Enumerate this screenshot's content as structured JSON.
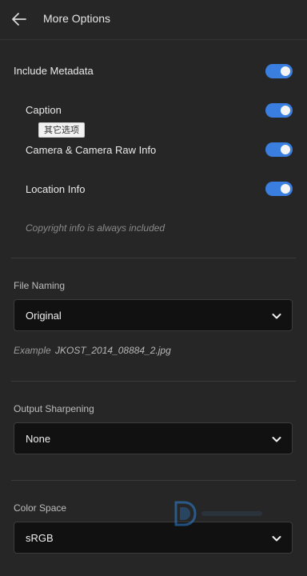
{
  "header": {
    "title": "More Options",
    "back_icon": "arrow-left-icon"
  },
  "metadata": {
    "include_label": "Include Metadata",
    "include_on": true,
    "items": [
      {
        "label": "Caption",
        "on": true
      },
      {
        "label": "Camera & Camera Raw Info",
        "on": true
      },
      {
        "label": "Location Info",
        "on": true
      }
    ],
    "tooltip": "其它选项",
    "note": "Copyright info is always included"
  },
  "file_naming": {
    "label": "File Naming",
    "value": "Original",
    "example_label": "Example",
    "example_value": "JKOST_2014_08884_2.jpg"
  },
  "output_sharpening": {
    "label": "Output Sharpening",
    "value": "None"
  },
  "color_space": {
    "label": "Color Space",
    "value": "sRGB"
  },
  "colors": {
    "accent": "#3a7fe0",
    "background": "#262626",
    "select_bg": "#111111"
  }
}
